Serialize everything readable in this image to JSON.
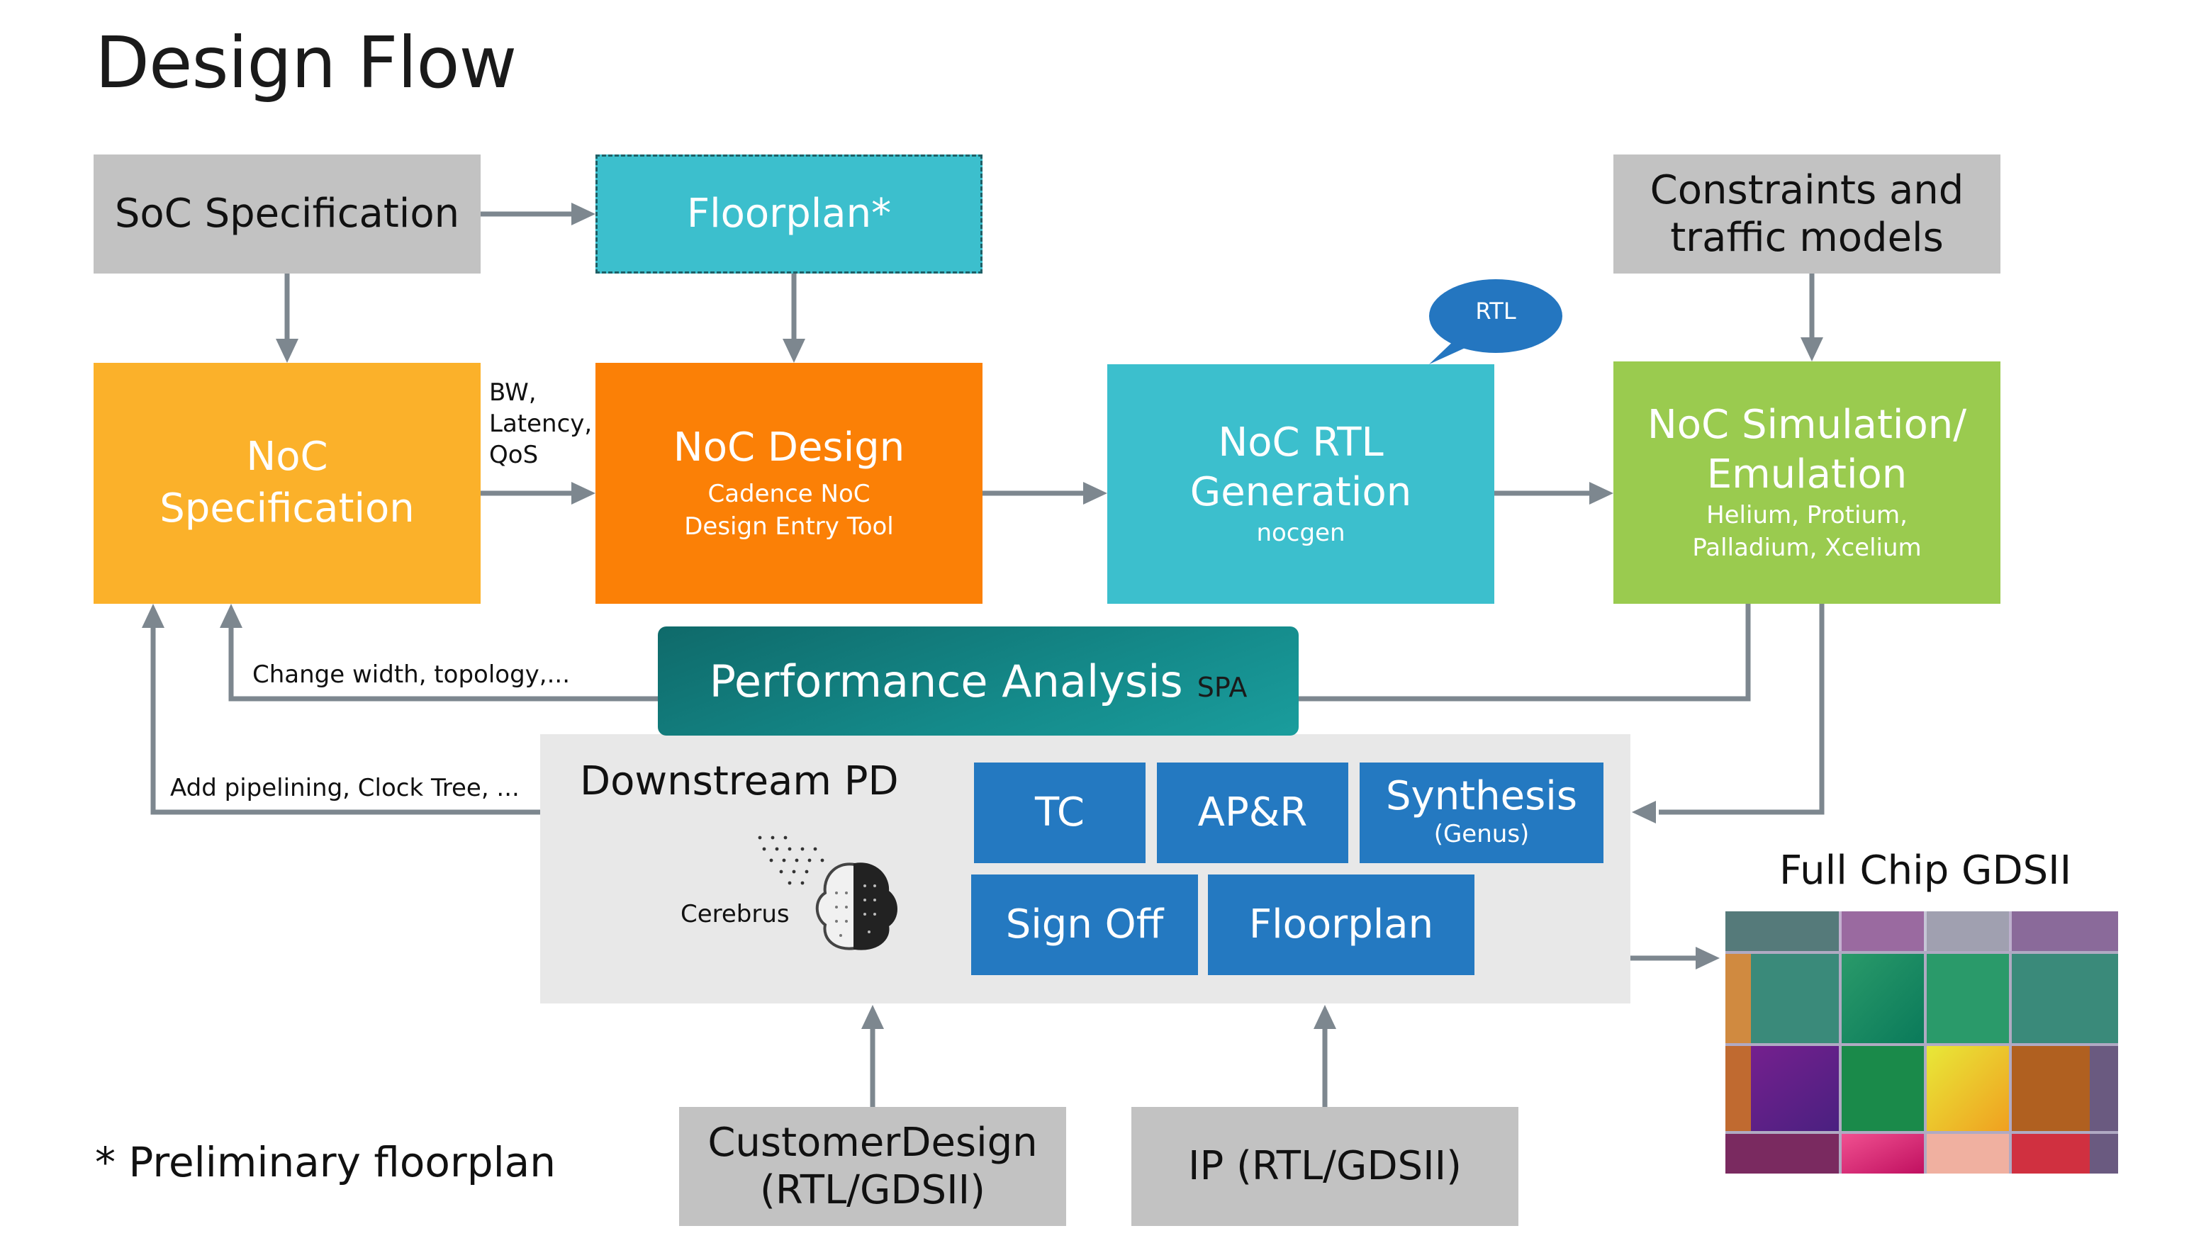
{
  "title": "Design Flow",
  "boxes": {
    "soc_spec": {
      "label": "SoC Specification",
      "color": "#c2c2c2"
    },
    "floorplan_prelim": {
      "label": "Floorplan*",
      "color": "#3cbfcd"
    },
    "constraints": {
      "line1": "Constraints and",
      "line2": "traffic models",
      "color": "#c2c2c2"
    },
    "noc_spec": {
      "line1": "NoC",
      "line2": "Specification",
      "color": "#fbb12a"
    },
    "noc_design": {
      "label": "NoC Design",
      "sub1": "Cadence NoC",
      "sub2": "Design Entry Tool",
      "color": "#fb8006"
    },
    "noc_rtl": {
      "line1": "NoC RTL",
      "line2": "Generation",
      "sub": "nocgen",
      "color": "#3cbfcd"
    },
    "noc_sim": {
      "line1": "NoC Simulation/",
      "line2": "Emulation",
      "sub1": "Helium, Protium,",
      "sub2": "Palladium, Xcelium",
      "color": "#9acb4f"
    },
    "perf_analysis": {
      "label": "Performance Analysis",
      "tag": "SPA",
      "color": "#138482"
    },
    "downstream": {
      "label": "Downstream PD",
      "brain_label": "Cerebrus",
      "color": "#e8e8e8"
    },
    "customer_design": {
      "line1": "CustomerDesign",
      "line2": "(RTL/GDSII)",
      "color": "#c2c2c2"
    },
    "ip": {
      "label": "IP (RTL/GDSII)",
      "color": "#c2c2c2"
    }
  },
  "pd_blocks": [
    {
      "label": "TC",
      "sub": ""
    },
    {
      "label": "AP&R",
      "sub": ""
    },
    {
      "label": "Synthesis",
      "sub": "(Genus)"
    },
    {
      "label": "Sign Off",
      "sub": ""
    },
    {
      "label": "Floorplan",
      "sub": ""
    }
  ],
  "pd_block_color": "#2479c1",
  "rtl_bubble": {
    "label": "RTL",
    "color": "#2476c0"
  },
  "edge_labels": {
    "bw": [
      "BW,",
      "Latency,",
      "QoS"
    ],
    "change_width": "Change width, topology,...",
    "add_pipelining": "Add pipelining, Clock Tree, ..."
  },
  "full_chip": {
    "label": "Full Chip GDSII"
  },
  "footnote": "* Preliminary floorplan",
  "connector_color": "#7d878f"
}
